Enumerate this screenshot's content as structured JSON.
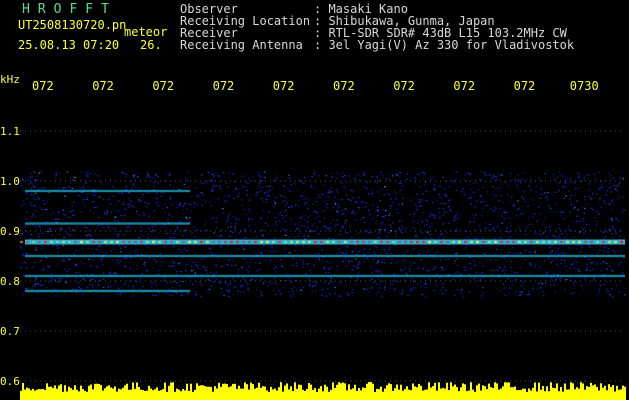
{
  "header": {
    "title": "HROFFT",
    "filename": "UT2508130720.pn",
    "kind": "meteor",
    "date_time": "25.08.13 07:20",
    "temperature": "26."
  },
  "meta": [
    {
      "label": "Observer",
      "value": ": Masaki Kano"
    },
    {
      "label": "Receiving Location",
      "value": ": Shibukawa, Gunma, Japan"
    },
    {
      "label": "Receiver",
      "value": ": RTL-SDR SDR# 43dB L15 103.2MHz CW"
    },
    {
      "label": "Receiving Antenna",
      "value": ": 3el Yagi(V) Az 330 for Vladivostok"
    }
  ],
  "chart_data": {
    "type": "heatmap",
    "y_unit": "kHz",
    "y_ticks": [
      "1.1",
      "1.0",
      "0.9",
      "0.8",
      "0.7",
      "0.6"
    ],
    "y_range": [
      0.6,
      1.1
    ],
    "x_ticks": [
      "072",
      "072",
      "072",
      "072",
      "072",
      "072",
      "072",
      "072",
      "072",
      "0730"
    ],
    "colors": {
      "background": "#000000",
      "tick_text": "#ffff33",
      "grid": "#505050",
      "signal_low": "#1c2cff",
      "signal_mid": "#22d4ff",
      "signal_high": "#ff2020",
      "baseline_level": "#ffff00"
    },
    "bands_khz": [
      0.98,
      0.915,
      0.878,
      0.85,
      0.81,
      0.78
    ]
  }
}
